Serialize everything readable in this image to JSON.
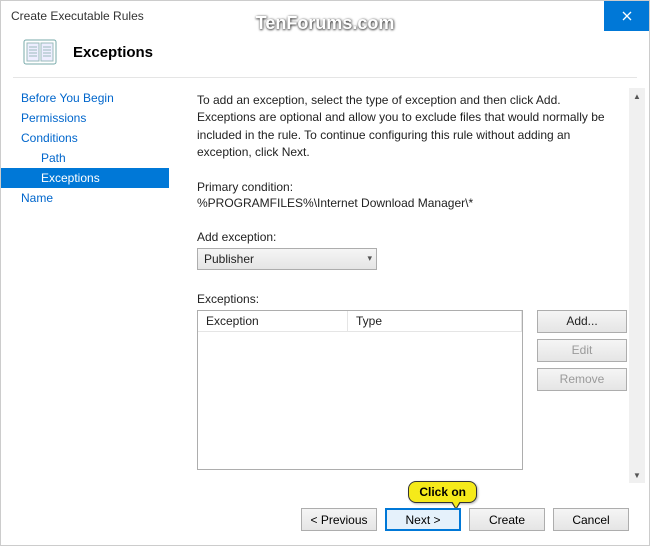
{
  "window": {
    "title": "Create Executable Rules"
  },
  "watermark": "TenForums.com",
  "header": {
    "title": "Exceptions"
  },
  "sidebar": {
    "items": [
      {
        "label": "Before You Begin",
        "indent": false,
        "selected": false
      },
      {
        "label": "Permissions",
        "indent": false,
        "selected": false
      },
      {
        "label": "Conditions",
        "indent": false,
        "selected": false
      },
      {
        "label": "Path",
        "indent": true,
        "selected": false
      },
      {
        "label": "Exceptions",
        "indent": true,
        "selected": true
      },
      {
        "label": "Name",
        "indent": false,
        "selected": false
      }
    ]
  },
  "content": {
    "description": "To add an exception, select the type of exception and then click Add. Exceptions are optional and allow you to exclude files that would normally be included in the rule. To continue configuring this rule without adding an exception, click Next.",
    "primary_condition_label": "Primary condition:",
    "primary_condition_value": "%PROGRAMFILES%\\Internet Download Manager\\*",
    "add_exception_label": "Add exception:",
    "add_exception_value": "Publisher",
    "exceptions_label": "Exceptions:",
    "columns": {
      "exception": "Exception",
      "type": "Type"
    },
    "buttons": {
      "add": "Add...",
      "edit": "Edit",
      "remove": "Remove"
    }
  },
  "footer": {
    "previous": "< Previous",
    "next": "Next >",
    "create": "Create",
    "cancel": "Cancel"
  },
  "callout": "Click on"
}
